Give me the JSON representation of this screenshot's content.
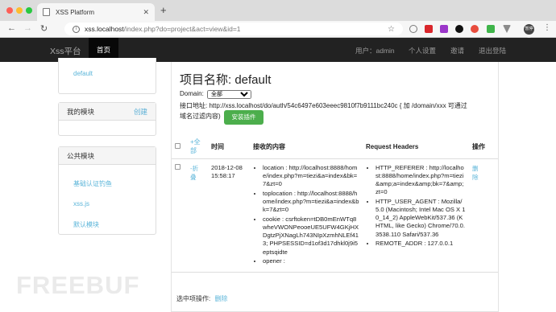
{
  "browser": {
    "tab_title": "XSS Platform",
    "url_host": "xss.localhost",
    "url_path": "/index.php?do=project&act=view&id=1",
    "avatar_text": "暂停中"
  },
  "navbar": {
    "brand": "Xss平台",
    "home": "首页",
    "user": "用户：admin",
    "settings": "个人设置",
    "invite": "邀请",
    "logout": "退出登陆"
  },
  "sidebar": {
    "project_link": "default",
    "my_modules": {
      "title": "我的模块",
      "create": "创建"
    },
    "public_modules": {
      "title": "公共模块",
      "items": [
        "基础认证钓鱼",
        "xss.js",
        "默认模块"
      ]
    }
  },
  "main": {
    "title": "项目名称: default",
    "domain_label": "Domain:",
    "domain_value": "全部",
    "api_line1": "接口地址: http://xss.localhost/do/auth/54c6497e603eeec9810f7b9111bc240c { 加 /domain/xxx 可通过",
    "api_line2": "域名过滤内容)",
    "install_button": "安装插件",
    "table": {
      "select_all_1": "+全",
      "select_all_2": "部",
      "headers": [
        "时间",
        "接收的内容",
        "Request Headers",
        "操作"
      ],
      "row": {
        "toggle_1": "-折",
        "toggle_2": "叠",
        "time": "2018-12-08 15:58:17",
        "content": [
          "location : http://localhost:8888/home/index.php?m=tiezi&a=index&bk=7&zt=0",
          "toplocation : http://localhost:8888/home/index.php?m=tiezi&a=index&bk=7&zt=0",
          "cookie : csrftoken=tDB0mEnWTq8wheVWONPeooeUE5UFW4GKjHXDgtzPjXNagLh743NIpXzmhNLEf413; PHPSESSID=d1of3d17dhkl0j9i5eptsqidte",
          "opener :"
        ],
        "headers": [
          "HTTP_REFERER : http://localhost:8888/home/index.php?m=tiezi&amp;a=index&amp;bk=7&amp;zt=0",
          "HTTP_USER_AGENT : Mozilla/5.0 (Macintosh; Intel Mac OS X 10_14_2) AppleWebKit/537.36 (KHTML, like Gecko) Chrome/70.0.3538.110 Safari/537.36",
          "REMOTE_ADDR : 127.0.0.1"
        ],
        "delete": "删除"
      }
    },
    "footer_label": "选中项操作:",
    "footer_delete": "删除"
  },
  "watermark": "FREEBUF",
  "colors": {
    "navbar": "#222222",
    "link": "#5bb5d9",
    "install_button": "#4cae4c"
  }
}
